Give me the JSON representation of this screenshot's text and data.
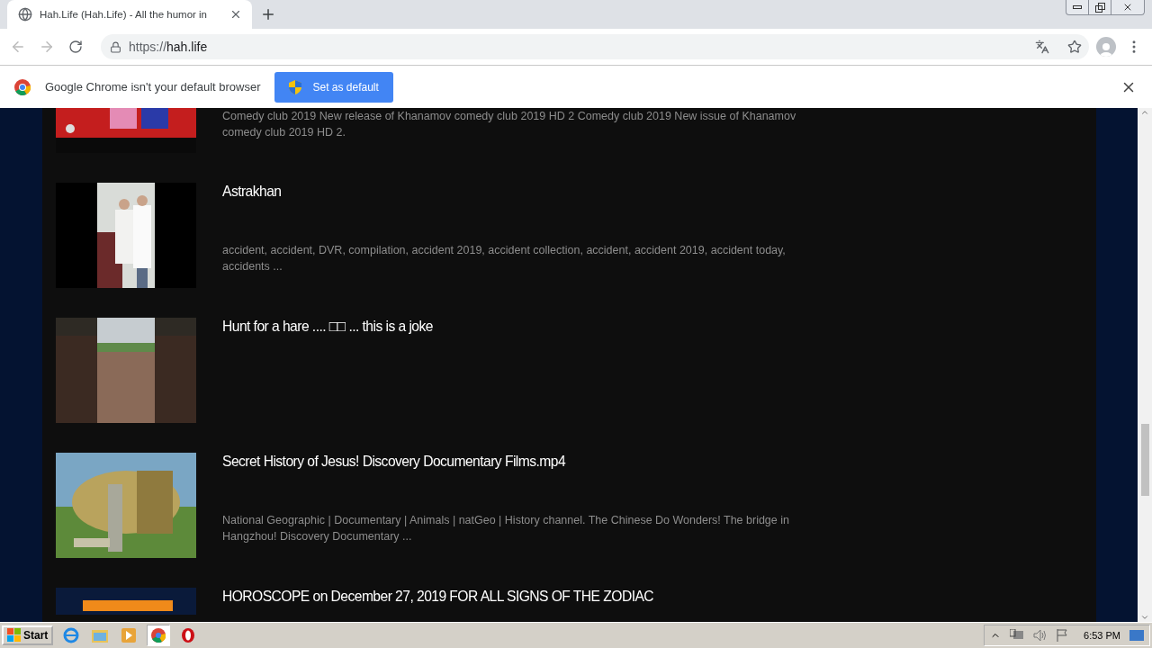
{
  "tab": {
    "title": "Hah.Life (Hah.Life) - All the humor in",
    "selected": true
  },
  "address": {
    "url_prefix": "https://",
    "url_host": "hah.life"
  },
  "infobar": {
    "message": "Google Chrome isn't your default browser",
    "button": "Set as default"
  },
  "items": [
    {
      "kind": "partial",
      "description": "Comedy club 2019 New release of Khanamov comedy club 2019 HD 2 Comedy club 2019 New issue of Khanamov comedy club 2019 HD 2."
    },
    {
      "kind": "full",
      "title": "Astrakhan",
      "description": "accident, accident, DVR, compilation, accident 2019, accident collection, accident, accident 2019, accident today, accidents ..."
    },
    {
      "kind": "full",
      "title": "Hunt for a hare .... □□ ... this is a joke"
    },
    {
      "kind": "full",
      "title": "Secret History of Jesus! Discovery Documentary Films.mp4",
      "description": "National Geographic | Documentary | Animals | natGeo | History channel. The Chinese Do Wonders! The bridge in Hangzhou! Discovery Documentary ..."
    },
    {
      "kind": "cut",
      "title": "HOROSCOPE on December 27, 2019 FOR ALL SIGNS OF THE ZODIAC"
    }
  ],
  "taskbar": {
    "start": "Start",
    "clock": "6:53 PM"
  }
}
